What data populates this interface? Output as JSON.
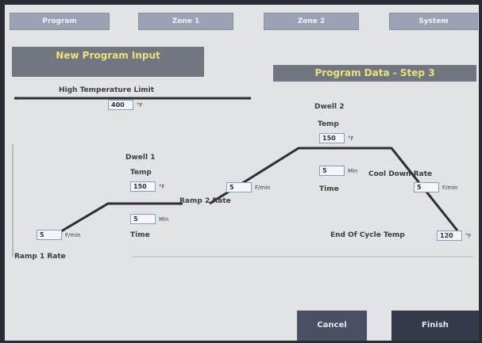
{
  "tabs": [
    "Program",
    "Zone 1",
    "Zone 2",
    "System"
  ],
  "header": {
    "title": "New Program Input",
    "subtitle": "Program Data - Step 3"
  },
  "high_temp": {
    "label": "High Temperature Limit",
    "value": "400",
    "unit": "°F"
  },
  "ramp1": {
    "label": "Ramp 1 Rate",
    "value": "5",
    "unit": "F/min"
  },
  "dwell1": {
    "title": "Dwell 1",
    "temp_label": "Temp",
    "temp": "150",
    "temp_unit": "°F",
    "time": "5",
    "time_unit": "Min",
    "time_label": "Time"
  },
  "ramp2": {
    "label": "Ramp 2 Rate",
    "value": "5",
    "unit": "F/min"
  },
  "dwell2": {
    "title": "Dwell 2",
    "temp_label": "Temp",
    "temp": "150",
    "temp_unit": "°F",
    "time": "5",
    "time_unit": "Min",
    "time_label": "Time"
  },
  "cooldown": {
    "label": "Cool Down Rate",
    "value": "5",
    "unit": "F/min"
  },
  "end_cycle": {
    "label": "End Of Cycle Temp",
    "value": "120",
    "unit": "°F"
  },
  "buttons": {
    "cancel": "Cancel",
    "finish": "Finish"
  },
  "colors": {
    "tab": "#9aa3b4",
    "header_bg": "#727680",
    "header_text": "#e9e27a",
    "field_border": "#7ca0c8",
    "cancel_bg": "#4a5064",
    "finish_bg": "#343a4a"
  }
}
